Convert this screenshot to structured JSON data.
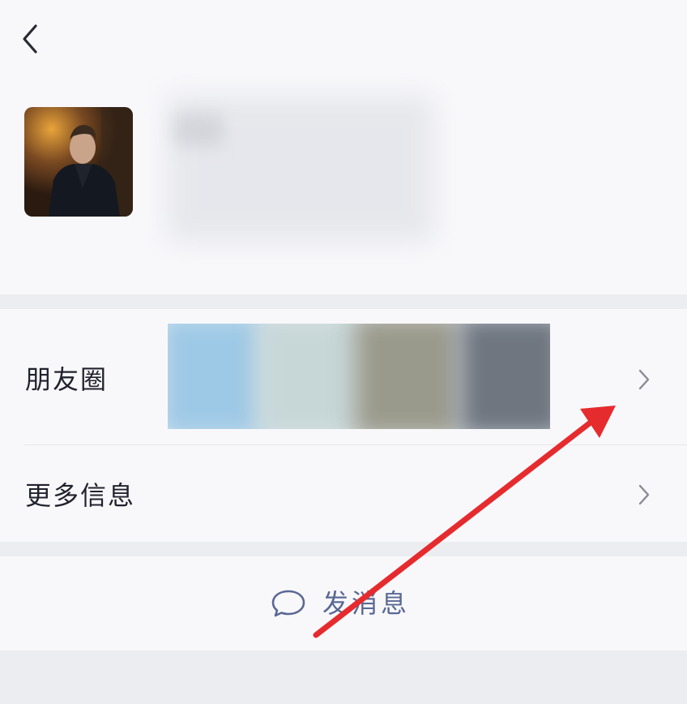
{
  "header": {
    "back_icon": "chevron-left-icon"
  },
  "profile": {
    "avatar_desc": "avatar",
    "name_blurred": true
  },
  "menu": {
    "moments_label": "朋友圈",
    "more_info_label": "更多信息",
    "chevron_icon": "chevron-right-icon"
  },
  "actions": {
    "send_message_label": "发消息",
    "send_message_icon": "chat-bubble-icon"
  },
  "colors": {
    "background": "#ecedf0",
    "card": "#f8f8fb",
    "accent_text": "#5a6894",
    "arrow": "#e62b2e"
  }
}
